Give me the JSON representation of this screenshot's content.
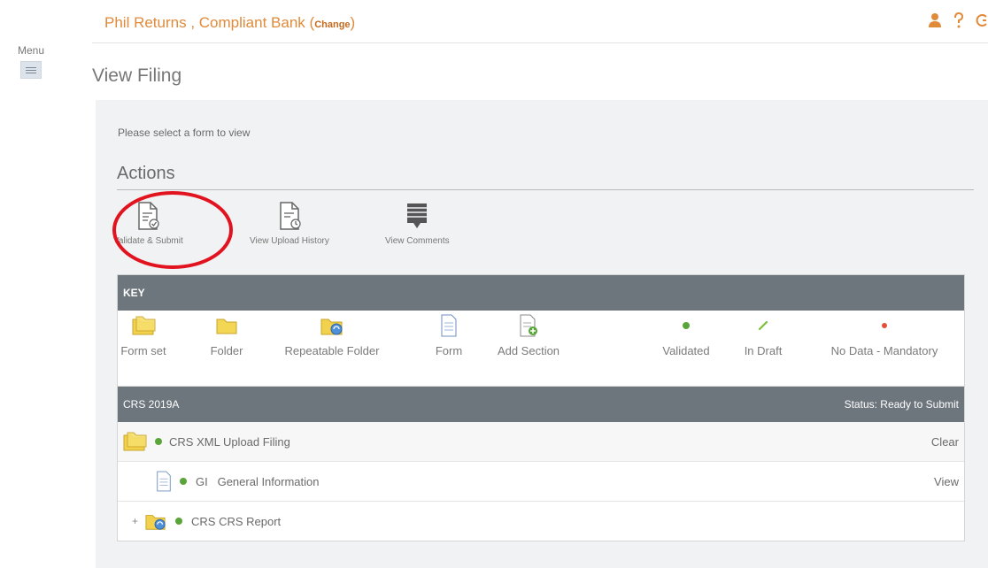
{
  "menu": {
    "label": "Menu"
  },
  "header": {
    "brand": "Phil Returns , Compliant Bank",
    "change_open": "(",
    "change_label": "Change",
    "change_close": ")",
    "icons": [
      "user-icon",
      "help-icon",
      "power-icon"
    ]
  },
  "page": {
    "title": "View Filing"
  },
  "panel": {
    "prompt": "Please select a form to view"
  },
  "actions": {
    "title": "Actions",
    "items": [
      {
        "label": "Validate & Submit",
        "icon": "validate-submit-icon"
      },
      {
        "label": "View Upload History",
        "icon": "upload-history-icon"
      },
      {
        "label": "View Comments",
        "icon": "comments-icon"
      }
    ]
  },
  "key": {
    "title": "KEY",
    "items": [
      {
        "label": "Form set",
        "icon": "form-set-icon"
      },
      {
        "label": "Folder",
        "icon": "folder-icon"
      },
      {
        "label": "Repeatable Folder",
        "icon": "repeatable-folder-icon"
      },
      {
        "label": "Form",
        "icon": "form-icon"
      },
      {
        "label": "Add Section",
        "icon": "add-section-icon"
      },
      {
        "label": "Validated",
        "icon": "validated-icon"
      },
      {
        "label": "In Draft",
        "icon": "in-draft-icon"
      },
      {
        "label": "No Data - Mandatory",
        "icon": "no-data-mandatory-icon"
      }
    ]
  },
  "filing": {
    "name": "CRS 2019A",
    "status": "Status: Ready to Submit",
    "rows": [
      {
        "code": "CRS",
        "label": "XML Upload Filing",
        "action": "Clear"
      },
      {
        "code": "GI",
        "label": "General Information",
        "action": "View"
      },
      {
        "code": "CRS",
        "label": "CRS Report",
        "expander": "+"
      }
    ]
  },
  "colors": {
    "accent": "#e08a3a",
    "bar": "#6d757d",
    "validated": "#5aa53a",
    "draft": "#7bbf3a",
    "mandatory": "#e0503a",
    "highlight": "#e1131f"
  }
}
